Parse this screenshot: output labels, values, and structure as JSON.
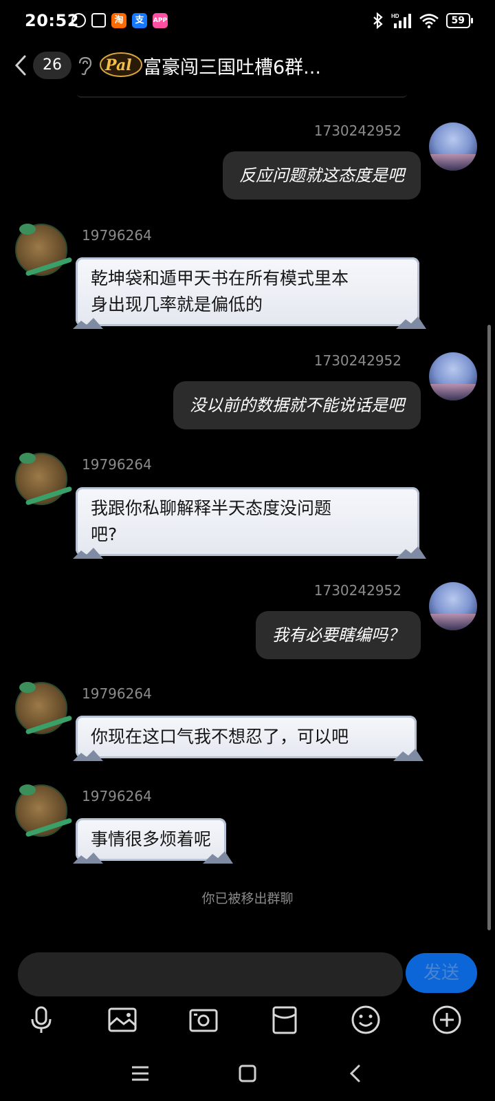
{
  "status_bar": {
    "time": "20:52",
    "battery": "59",
    "signal_badge": "HD"
  },
  "header": {
    "unread_count": "26",
    "title": "富豪闯三国吐槽6群...",
    "logo_text": "Pal"
  },
  "messages": [
    {
      "side": "self",
      "sender": "1730242952",
      "text": "反应问题就这态度是吧"
    },
    {
      "side": "other",
      "sender": "19796264",
      "lines": [
        "乾坤袋和遁甲天书在所有模式里本",
        "身出现几率就是偏低的"
      ]
    },
    {
      "side": "self",
      "sender": "1730242952",
      "text": "没以前的数据就不能说话是吧"
    },
    {
      "side": "other",
      "sender": "19796264",
      "lines": [
        "我跟你私聊解释半天态度没问题",
        "吧?"
      ]
    },
    {
      "side": "self",
      "sender": "1730242952",
      "text": "我有必要瞎编吗？"
    },
    {
      "side": "other",
      "sender": "19796264",
      "lines": [
        "你现在这口气我不想忍了，可以吧"
      ]
    },
    {
      "side": "other",
      "sender": "19796264",
      "lines": [
        "事情很多烦着呢"
      ]
    }
  ],
  "system_notice": "你已被移出群聊",
  "input": {
    "value": "",
    "send_label": "发送"
  },
  "toolbar": [
    "mic-icon",
    "image-icon",
    "camera-icon",
    "red-packet-icon",
    "emoji-icon",
    "plus-icon"
  ],
  "navbar": [
    "menu-icon",
    "home-icon",
    "back-icon"
  ]
}
